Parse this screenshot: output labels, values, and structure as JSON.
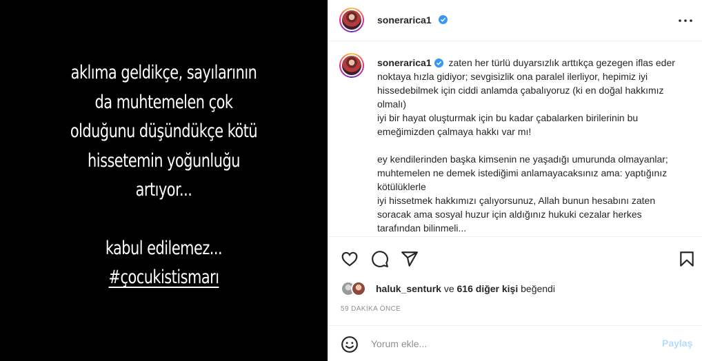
{
  "story": {
    "lines": [
      "aklıma geldikçe, sayılarının",
      "da muhtemelen çok",
      "olduğunu düşündükçe kötü",
      "hissetemin yoğunluğu",
      "artıyor..."
    ],
    "closing": [
      "kabul edilemez..."
    ],
    "hashtag": "#çocukistismarı"
  },
  "header": {
    "username": "sonerarica1",
    "more_icon": "more-horizontal-icon"
  },
  "caption": {
    "username": "sonerarica1",
    "text": "zaten her türlü duyarsızlık arttıkça gezegen iflas eder noktaya hızla gidiyor; sevgisizlik ona paralel ilerliyor, hepimiz iyi hissedebilmek için ciddi anlamda çabalıyoruz (ki en doğal hakkımız olmalı)\niyi bir hayat oluşturmak için bu kadar çabalarken birilerinin bu emeğimizden çalmaya hakkı var mı!\n\ney kendilerinden başka kimsenin ne yaşadığı umurunda olmayanlar; muhtemelen ne demek istediğimi anlamayacaksınız ama: yaptığınız kötülüklerle\niyi hissetmek hakkımızı çalıyorsunuz, Allah bunun hesabını zaten soracak ama sosyal huzur için aldığınız hukuki cezalar herkes tarafından bilinmeli..."
  },
  "actions": {
    "like_icon": "heart-icon",
    "comment_icon": "comment-icon",
    "share_icon": "send-icon",
    "save_icon": "bookmark-icon"
  },
  "likes": {
    "user": "haluk_senturk",
    "connector": " ve ",
    "others": "616 diğer kişi",
    "suffix": " beğendi"
  },
  "timestamp": "59 DAKİKA ÖNCE",
  "comment": {
    "placeholder": "Yorum ekle...",
    "post_label": "Paylaş",
    "emoji_icon": "smiley-icon"
  },
  "colors": {
    "verified": "#3897f0",
    "post_button_disabled": "#b3dbff",
    "muted": "#8e8e8e"
  }
}
